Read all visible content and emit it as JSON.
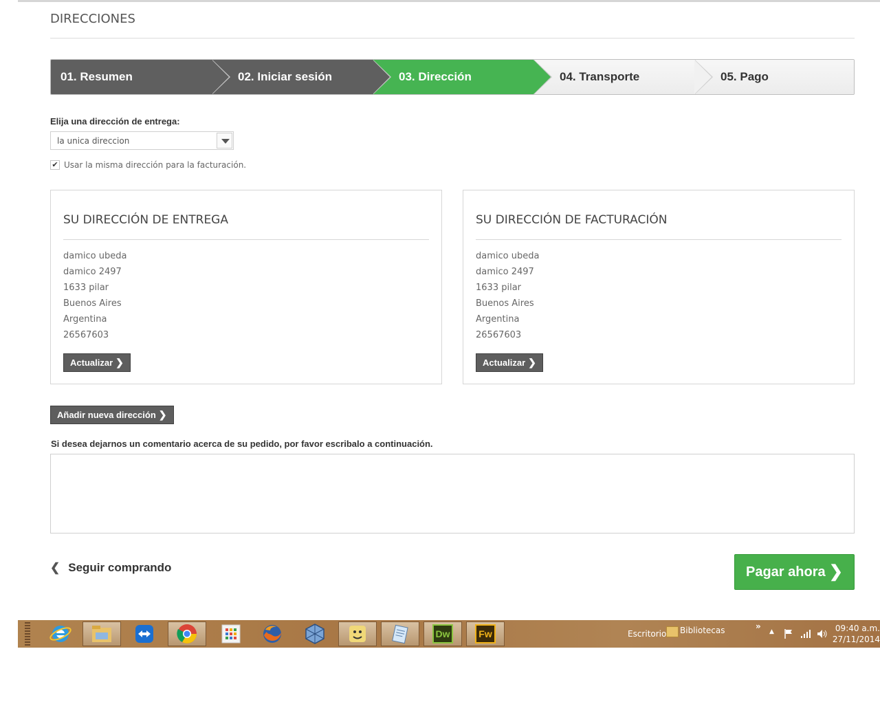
{
  "page": {
    "title": "DIRECCIONES"
  },
  "steps": [
    {
      "label": "01. Resumen",
      "state": "done"
    },
    {
      "label": "02. Iniciar sesión",
      "state": "done"
    },
    {
      "label": "03. Dirección",
      "state": "current"
    },
    {
      "label": "04. Transporte",
      "state": "todo"
    },
    {
      "label": "05. Pago",
      "state": "todo"
    }
  ],
  "address_select": {
    "label": "Elija una dirección de entrega:",
    "selected": "la unica direccion"
  },
  "same_billing": {
    "label": "Usar la misma dirección para la facturación.",
    "checked": true
  },
  "delivery": {
    "title": "SU DIRECCIÓN DE ENTREGA",
    "lines": [
      "damico ubeda",
      "damico 2497",
      "1633 pilar",
      "Buenos Aires",
      "Argentina",
      "26567603"
    ],
    "button": "Actualizar"
  },
  "billing": {
    "title": "SU DIRECCIÓN DE FACTURACIÓN",
    "lines": [
      "damico ubeda",
      "damico 2497",
      "1633 pilar",
      "Buenos Aires",
      "Argentina",
      "26567603"
    ],
    "button": "Actualizar"
  },
  "add_address": {
    "label": "Añadir nueva dirección"
  },
  "comment": {
    "label": "Si desea dejarnos un comentario acerca de su pedido, por favor escribalo a continuación.",
    "value": ""
  },
  "footer": {
    "continue_label": "Seguir comprando",
    "pay_label": "Pagar ahora"
  },
  "colors": {
    "step_done": "#5f5f5f",
    "step_current": "#46b452",
    "pay_button": "#47b04b",
    "dark_button": "#5e5e5e"
  },
  "taskbar": {
    "apps": [
      "internet-explorer-icon",
      "file-explorer-icon",
      "teamviewer-icon",
      "chrome-icon",
      "apps-grid-icon",
      "firefox-icon",
      "virtualbox-icon",
      "finder-icon",
      "notepad-icon",
      "dreamweaver-icon",
      "fireworks-icon"
    ],
    "dw_text": "Dw",
    "fw_text": "Fw",
    "toolbar_desktop": "Escritorio",
    "toolbar_libraries": "Bibliotecas",
    "overflow": "»",
    "time": "09:40 a.m.",
    "date": "27/11/2014"
  }
}
